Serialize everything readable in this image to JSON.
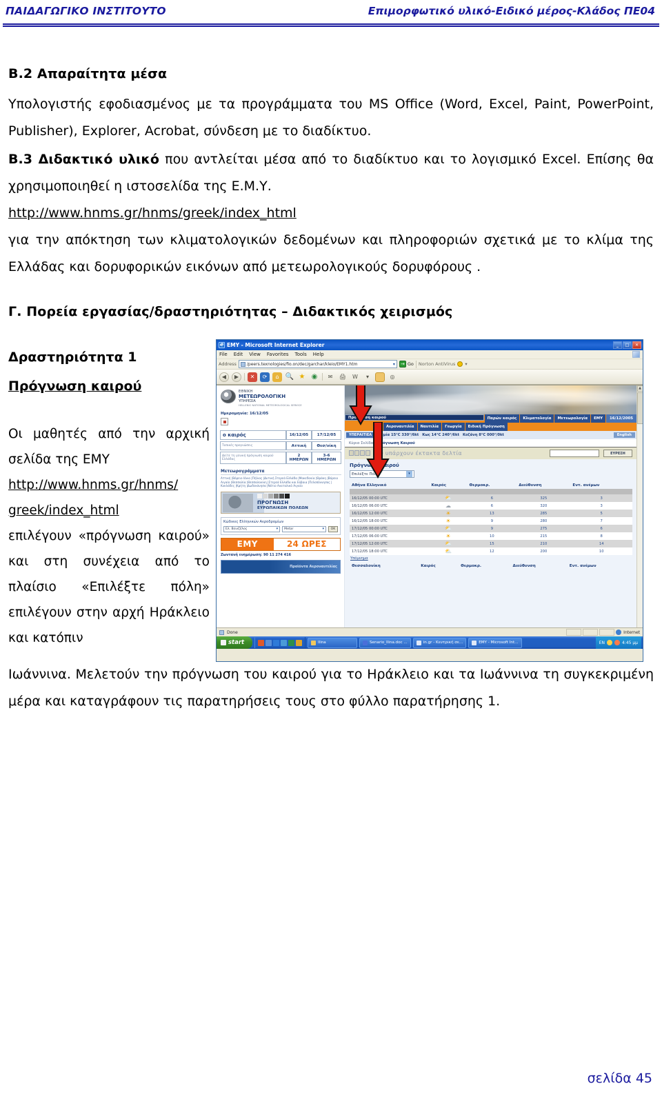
{
  "page_header": {
    "left": "ΠΑΙΔΑΓΩΓΙΚΟ ΙΝΣΤΙΤΟΥΤΟ",
    "right": "Επιμορφωτικό υλικό-Ειδικό μέρος-Κλάδος ΠΕ04",
    "accent_color": "#1a1a9e"
  },
  "page_footer": {
    "page_label": "σελίδα 45",
    "color": "#1a1a9e"
  },
  "sections": {
    "b2_heading": "Β.2 Απαραίτητα μέσα",
    "b2_body": "Υπολογιστής εφοδιασμένος με τα προγράμματα του MS Office (Word, Excel, Paint, PowerPoint, Publisher), Explorer, Acrobat, σύνδεση με το διαδίκτυο.",
    "b3_label": "Β.3 Διδακτικό υλικό",
    "b3_body": " που αντλείται μέσα από το διαδίκτυο και το λογισμικό Excel. Επίσης θα χρησιμοποιηθεί η ιστοσελίδα της Ε.Μ.Υ.",
    "b3_link": "http://www.hnms.gr/hnms/greek/index_html",
    "b3_body2": "για την απόκτηση των κλιματολογικών δεδομένων και πληροφοριών σχετικά με το κλίμα της Ελλάδας και δορυφορικών εικόνων από μετεωρολογικούς δορυφόρους .",
    "c_heading": "Γ. Πορεία εργασίας/δραστηριότητας – Διδακτικός χειρισμός",
    "activity_title": "Δραστηριότητα 1",
    "activity_subtitle": "Πρόγνωση καιρού",
    "left_text_1": "Οι μαθητές από την αρχική σελίδα της ΕΜΥ",
    "left_link": "http://www.hnms.gr/hnms/ greek/index_html",
    "left_text_2": "επιλέγουν «πρόγνωση καιρού» και στη συνέχεια από το πλαίσιο «Επιλέξτε πόλη» επιλέγουν στην αρχή Ηράκλειο και κατόπιν",
    "tail_text": "Ιωάννινα. Μελετούν την πρόγνωση του καιρού για το Ηράκλειο και τα Ιωάννινα τη συγκεκριμένη μέρα και καταγράφουν τις παρατηρήσεις τους στο φύλλο παρατήρησης 1."
  },
  "screenshot": {
    "window_title": "EMY - Microsoft Internet Explorer",
    "window_buttons": {
      "minimize": "_",
      "maximize": "□",
      "close": "✕"
    },
    "menu": [
      "File",
      "Edit",
      "View",
      "Favorites",
      "Tools",
      "Help"
    ],
    "address_label": "Address",
    "address_value": "/peers.texnologies/fio.on/dec/garchar/kleio/EMY1.htm",
    "go_label": "Go",
    "norton_label": "Norton AntiVirus",
    "toolbar_icons": [
      "back-icon",
      "forward-icon",
      "stop-icon",
      "refresh-icon",
      "home-icon",
      "search-icon",
      "favorites-icon",
      "history-icon",
      "mail-icon",
      "print-icon",
      "edit-icon",
      "folder-icon",
      "messenger-icon"
    ],
    "site": {
      "logo_line1": "ΕΘΝΙΚΗ",
      "logo_line2": "ΜΕΤΕΩΡΟΛΟΓΙΚΗ",
      "logo_line3": "ΥΠΗΡΕΣΙΑ",
      "logo_line4": "HELLENIC NATIONAL METEOROLOGICAL SERVICE",
      "date_line": "Ημερομηνία: 16/12/05",
      "weather_box": {
        "title": "ο καιρός",
        "dates": [
          "16/12/05",
          "17/12/05"
        ],
        "row2_label": "Τοπικές προγνώσεις",
        "row2_values": [
          "Αττική",
          "Θεσ/νίκη"
        ],
        "row3_label": "Δείτε τη γενική πρόγνωση καιρού Ελλάδας",
        "row3_values": [
          "2 ΗΜΕΡΩΝ",
          "3-6 ΗΜΕΡΩΝ"
        ]
      },
      "meteograms_title": "Μετεωρογράμματα",
      "meteograms_list": "Αττική |Βόρειο Ιόνιο |Πήλιος |Δυτική Στερεά Ελλάδα |Μακεδονία |Θράκη |Βόρειο Αιγαίο |Θεσσαλία |Θεσσαλονίκη |Στερεά Ελλάδα και Εύβοια |Πελοπόννησος |Κυκλάδες |Κρήτη |Δωδεκάνησα |Νότιο Ανατολικό Αιγαίο",
      "banner_line1": "ΠΡΟΓΝΩΣΗ",
      "banner_line2": "ΕΥΡΩΠΑΙΚΩΝ ΠΟΛΕΩΝ",
      "codes_title": "Κώδικες Ελληνικών Αεροδρομίων",
      "codes_select_1": "Ελ. Βενιζέλος",
      "codes_select_2": "Metar",
      "codes_ok": "OK",
      "emy24_left": "ΕΜΥ",
      "emy24_right": "24 ΩΡΕΣ",
      "live_line": "Ζωντανή ενημέρωση: 90 11 274 416",
      "blue_banner": "Προϊόντα Αεροναυτιλίας",
      "nav_primary": [
        "Πρόγνωση καιρού",
        "Παρών καιρός",
        "Κλιματολογία",
        "Μετεωρολογία",
        "ΕΜΥ"
      ],
      "nav_date": "16/12/2005",
      "nav_secondary": [
        "Αεροναυτιλία",
        "Ναυτιλία",
        "Γεωργία",
        "Ειδική Πρόγνωση"
      ],
      "ticker_tag": "ΥΠΕΡΑΙΤΙΕΑ",
      "ticker_items": [
        "Λαμία 15°C 330°/6kt",
        "Κως 14°C 240°/6kt",
        "Κοζάνη 8°C 000°/0kt"
      ],
      "ticker_english": "English",
      "breadcrumb_home": "Κύρια Σελίδα",
      "breadcrumb_current": "Πρόγνωση Καιρού",
      "alert_text": "Δεν υπάρχουν έκτακτα δελτία",
      "search_button": "ΕΥΡΕΣΗ",
      "forecast_label": "Πρόγνωση Καιρού",
      "city_select_value": "Επιλέξτε Πόλη",
      "table_headers": [
        "Αθήνα Ελληνικό",
        "Καιρός",
        "Θερμοκρ.",
        "Διεύθυνση",
        "Εντ. ανέμων"
      ],
      "legend_link": "Υπόμνημα",
      "second_table_city": "Θεσσαλονίκη",
      "second_table_headers": [
        "Θεσσαλονίκη",
        "Καιρός",
        "Θερμοκρ.",
        "Διεύθυνση",
        "Εντ. ανέμων"
      ]
    },
    "status": {
      "done": "Done",
      "zone": "Internet"
    },
    "taskbar": {
      "start": "start",
      "items": [
        "Ilina",
        "Senario_Ilina.doc ...",
        "in.gr - Κεντρική σε...",
        "EMY - Microsoft Int..."
      ],
      "lang": "EN",
      "clock": "4:45 μμ"
    },
    "annotations": [
      {
        "name": "arrow-to-forecast-tab",
        "color": "#e01b10"
      },
      {
        "name": "arrow-to-city-select",
        "color": "#e01b10"
      }
    ]
  },
  "chart_data": {
    "type": "table",
    "title": "Πρόγνωση Καιρού — Αθήνα Ελληνικό",
    "columns": [
      "Αθήνα Ελληνικό",
      "Καιρός",
      "Θερμοκρ.",
      "Διεύθυνση",
      "Εντ. ανέμων"
    ],
    "rows": [
      {
        "time": "16/12/05 00:00 UTC",
        "icon": "partly-cloudy",
        "temp": "6",
        "temp_unit": "°C",
        "direction": "325",
        "dir_unit": "°",
        "wind": "3",
        "wind_unit": "kt"
      },
      {
        "time": "16/12/05 06:00 UTC",
        "icon": "cloudy",
        "temp": "6",
        "temp_unit": "°C",
        "direction": "320",
        "dir_unit": "°",
        "wind": "3",
        "wind_unit": "kt"
      },
      {
        "time": "16/12/05 12:00 UTC",
        "icon": "sunny",
        "temp": "13",
        "temp_unit": "°C",
        "direction": "285",
        "dir_unit": "°",
        "wind": "5",
        "wind_unit": "kt"
      },
      {
        "time": "16/12/05 18:00 UTC",
        "icon": "sunny",
        "temp": "9",
        "temp_unit": "°C",
        "direction": "280",
        "dir_unit": "°",
        "wind": "7",
        "wind_unit": "kt"
      },
      {
        "time": "17/12/05 00:00 UTC",
        "icon": "partly-cloudy",
        "temp": "9",
        "temp_unit": "°C",
        "direction": "275",
        "dir_unit": "°",
        "wind": "6",
        "wind_unit": "kt"
      },
      {
        "time": "17/12/05 06:00 UTC",
        "icon": "sunny",
        "temp": "10",
        "temp_unit": "°C",
        "direction": "215",
        "dir_unit": "°",
        "wind": "8",
        "wind_unit": "kt"
      },
      {
        "time": "17/12/05 12:00 UTC",
        "icon": "partly-cloudy",
        "temp": "15",
        "temp_unit": "°C",
        "direction": "210",
        "dir_unit": "°",
        "wind": "14",
        "wind_unit": "kt"
      },
      {
        "time": "17/12/05 18:00 UTC",
        "icon": "partly-cloudy",
        "temp": "12",
        "temp_unit": "°C",
        "direction": "200",
        "dir_unit": "°",
        "wind": "10",
        "wind_unit": "kt"
      }
    ]
  }
}
